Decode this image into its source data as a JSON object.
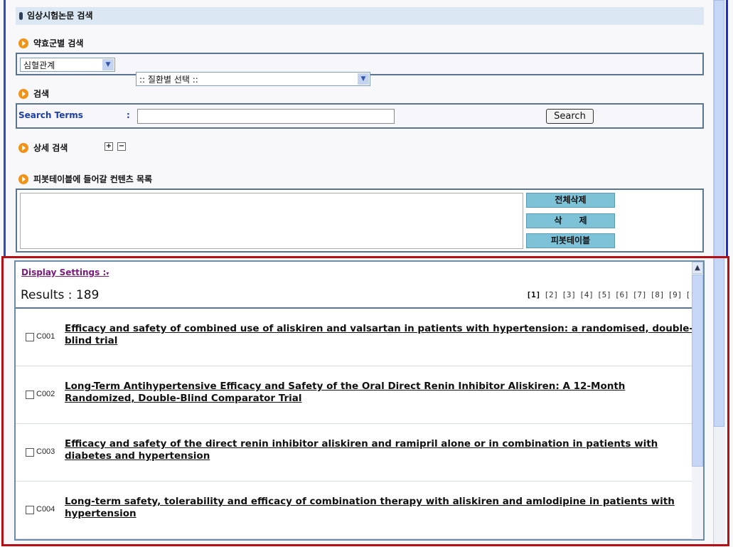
{
  "header": {
    "title": "임상시험논문 검색"
  },
  "drug_section": {
    "label": "약효군별 검색",
    "category_select": "심혈관계",
    "disease_select": ":: 질환별 선택 ::"
  },
  "search_section": {
    "label": "검색",
    "terms_label": "Search Terms",
    "colon": ":",
    "input_value": "",
    "search_button": "Search"
  },
  "advanced": {
    "label": "상세 검색",
    "plus": "+",
    "minus": "−"
  },
  "pivot": {
    "label": "피봇테이블에 들어갈 컨텐츠 목록",
    "delete_all": "전체삭제",
    "delete": "삭　　제",
    "pivot_table": "피봇테이블"
  },
  "results": {
    "display_settings": "Display Settings :",
    "count_label": "Results : 189",
    "pages": [
      "[1]",
      "[2]",
      "[3]",
      "[4]",
      "[5]",
      "[6]",
      "[7]",
      "[8]",
      "[9]",
      "["
    ],
    "current_page": "[1]",
    "items": [
      {
        "code": "C001",
        "title": "Efficacy and safety of combined use of aliskiren and valsartan in patients with hypertension: a randomised, double-blind trial"
      },
      {
        "code": "C002",
        "title": "Long-Term Antihypertensive Efficacy and Safety of the Oral Direct Renin Inhibitor Aliskiren: A 12-Month Randomized, Double-Blind Comparator Trial"
      },
      {
        "code": "C003",
        "title": "Efficacy and safety of the direct renin inhibitor aliskiren and ramipril alone or in combination in patients with diabetes and hypertension"
      },
      {
        "code": "C004",
        "title": "Long-term safety, tolerability and efficacy of combination therapy with aliskiren and amlodipine in patients with hypertension"
      }
    ]
  },
  "colors": {
    "highlight_box": "#b30f14",
    "section_bullet": "#f29218",
    "button_bg": "#7ec2d8",
    "header_bg": "#dbe8f4"
  }
}
